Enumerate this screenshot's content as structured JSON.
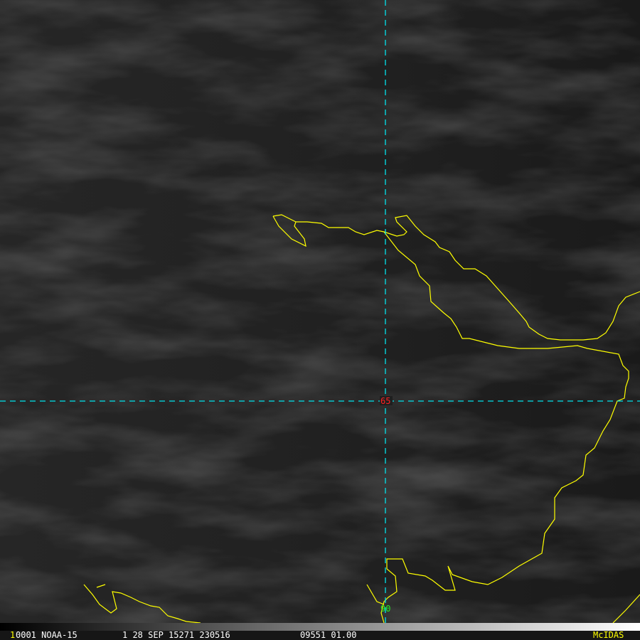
{
  "image": {
    "satellite": "NOAA-15",
    "colors": {
      "coastline": "#ffff00",
      "gridline": "#00e5ee",
      "lat_label": "#ff2020",
      "lon_label": "#22ee22",
      "logo": "#ffff00"
    }
  },
  "grid_labels": {
    "latitude": "65",
    "longitude": "90"
  },
  "status_bar": {
    "frame_prefix": "1",
    "frame": "0001 NOAA-15",
    "date": "1 28 SEP 15271 230516",
    "band": "09551 01.00",
    "logo": "McIDAS"
  }
}
